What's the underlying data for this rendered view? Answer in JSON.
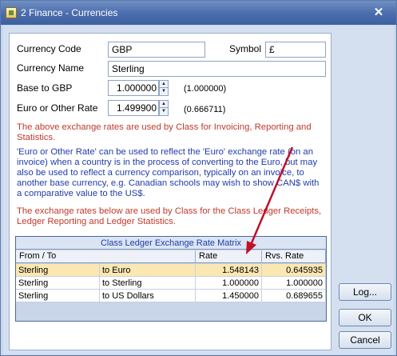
{
  "window": {
    "title": "2 Finance - Currencies",
    "close_label": "✕"
  },
  "form": {
    "currency_code_label": "Currency Code",
    "currency_code_value": "GBP",
    "symbol_label": "Symbol",
    "symbol_value": "£",
    "currency_name_label": "Currency Name",
    "currency_name_value": "Sterling",
    "base_label": "Base to GBP",
    "base_value": "1.000000",
    "base_inverse": "(1.000000)",
    "euro_label": "Euro or Other Rate",
    "euro_value": "1.499900",
    "euro_inverse": "(0.666711)"
  },
  "info": {
    "para1_line1": "The above exchange rates are used by Class for Invoicing, Reporting and",
    "para1_line2": "Statistics.",
    "para2_line1": "'Euro or Other Rate' can be used to reflect the 'Euro' exchange rate (on an",
    "para2_line2": "invoice) when a country is in the process of converting to the Euro, but may",
    "para2_line3": "also be used to reflect a currency comparison, typically on an invoice, to",
    "para2_line4": "another base currency, e.g. Canadian schools may wish to show CAN$ with",
    "para2_line5": "a comparative value to the US$.",
    "para3_line1": "The exchange rates below are used by Class for the Class Ledger Receipts,",
    "para3_line2": "Ledger Reporting and Ledger Statistics."
  },
  "grid": {
    "title": "Class Ledger Exchange Rate Matrix",
    "headers": {
      "from_to": "From / To",
      "rate": "Rate",
      "rvs_rate": "Rvs. Rate"
    },
    "rows": [
      {
        "from": "Sterling",
        "to": "to Euro",
        "rate": "1.548143",
        "rvs": "0.645935",
        "selected": true
      },
      {
        "from": "Sterling",
        "to": "to Sterling",
        "rate": "1.000000",
        "rvs": "1.000000",
        "selected": false
      },
      {
        "from": "Sterling",
        "to": "to US Dollars",
        "rate": "1.450000",
        "rvs": "0.689655",
        "selected": false
      }
    ]
  },
  "buttons": {
    "log": "Log...",
    "ok": "OK",
    "cancel": "Cancel"
  },
  "colors": {
    "title_bar": "#4a6cac",
    "warning_text": "#c0392b",
    "info_text": "#1f3da8",
    "selected_row": "#fbe7b2",
    "arrow": "#c0102a"
  }
}
